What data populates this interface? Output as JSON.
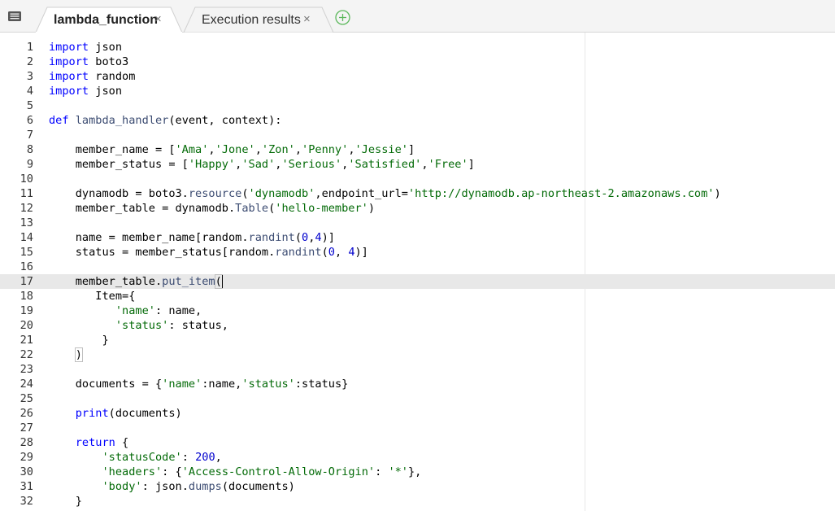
{
  "tabs": [
    {
      "label": "lambda_function",
      "close": "×",
      "active": true
    },
    {
      "label": "Execution results",
      "close": "×",
      "active": false
    }
  ],
  "add_tab_icon": "plus-circle-icon",
  "menu_icon": "menu-list-icon",
  "editor": {
    "active_line": 17,
    "lines": [
      [
        {
          "t": "import",
          "c": "kw"
        },
        {
          "t": " json"
        }
      ],
      [
        {
          "t": "import",
          "c": "kw"
        },
        {
          "t": " boto3"
        }
      ],
      [
        {
          "t": "import",
          "c": "kw"
        },
        {
          "t": " random"
        }
      ],
      [
        {
          "t": "import",
          "c": "kw"
        },
        {
          "t": " json"
        }
      ],
      [],
      [
        {
          "t": "def",
          "c": "kw"
        },
        {
          "t": " "
        },
        {
          "t": "lambda_handler",
          "c": "fn"
        },
        {
          "t": "(event, context):"
        }
      ],
      [],
      [
        {
          "t": "    member_name = ["
        },
        {
          "t": "'Ama'",
          "c": "str"
        },
        {
          "t": ","
        },
        {
          "t": "'Jone'",
          "c": "str"
        },
        {
          "t": ","
        },
        {
          "t": "'Zon'",
          "c": "str"
        },
        {
          "t": ","
        },
        {
          "t": "'Penny'",
          "c": "str"
        },
        {
          "t": ","
        },
        {
          "t": "'Jessie'",
          "c": "str"
        },
        {
          "t": "]"
        }
      ],
      [
        {
          "t": "    member_status = ["
        },
        {
          "t": "'Happy'",
          "c": "str"
        },
        {
          "t": ","
        },
        {
          "t": "'Sad'",
          "c": "str"
        },
        {
          "t": ","
        },
        {
          "t": "'Serious'",
          "c": "str"
        },
        {
          "t": ","
        },
        {
          "t": "'Satisfied'",
          "c": "str"
        },
        {
          "t": ","
        },
        {
          "t": "'Free'",
          "c": "str"
        },
        {
          "t": "]"
        }
      ],
      [],
      [
        {
          "t": "    dynamodb = boto3."
        },
        {
          "t": "resource",
          "c": "fn"
        },
        {
          "t": "("
        },
        {
          "t": "'dynamodb'",
          "c": "str"
        },
        {
          "t": ",endpoint_url="
        },
        {
          "t": "'http://dynamodb.ap-northeast-2.amazonaws.com'",
          "c": "str"
        },
        {
          "t": ")"
        }
      ],
      [
        {
          "t": "    member_table = dynamodb."
        },
        {
          "t": "Table",
          "c": "fn"
        },
        {
          "t": "("
        },
        {
          "t": "'hello-member'",
          "c": "str"
        },
        {
          "t": ")"
        }
      ],
      [],
      [
        {
          "t": "    name = member_name[random."
        },
        {
          "t": "randint",
          "c": "fn"
        },
        {
          "t": "("
        },
        {
          "t": "0",
          "c": "num"
        },
        {
          "t": ","
        },
        {
          "t": "4",
          "c": "num"
        },
        {
          "t": ")]"
        }
      ],
      [
        {
          "t": "    status = member_status[random."
        },
        {
          "t": "randint",
          "c": "fn"
        },
        {
          "t": "("
        },
        {
          "t": "0",
          "c": "num"
        },
        {
          "t": ", "
        },
        {
          "t": "4",
          "c": "num"
        },
        {
          "t": ")]"
        }
      ],
      [],
      [
        {
          "t": "    member_table."
        },
        {
          "t": "put_item",
          "c": "fn"
        },
        {
          "t": "(",
          "c": "hl"
        }
      ],
      [
        {
          "t": "       Item={"
        }
      ],
      [
        {
          "t": "          "
        },
        {
          "t": "'name'",
          "c": "str"
        },
        {
          "t": ": name,"
        }
      ],
      [
        {
          "t": "          "
        },
        {
          "t": "'status'",
          "c": "str"
        },
        {
          "t": ": status,"
        }
      ],
      [
        {
          "t": "        }"
        }
      ],
      [
        {
          "t": "    "
        },
        {
          "t": ")",
          "c": "hl"
        }
      ],
      [],
      [
        {
          "t": "    documents = {"
        },
        {
          "t": "'name'",
          "c": "str"
        },
        {
          "t": ":name,"
        },
        {
          "t": "'status'",
          "c": "str"
        },
        {
          "t": ":status}"
        }
      ],
      [],
      [
        {
          "t": "    "
        },
        {
          "t": "print",
          "c": "kw"
        },
        {
          "t": "(documents)"
        }
      ],
      [],
      [
        {
          "t": "    "
        },
        {
          "t": "return",
          "c": "kw"
        },
        {
          "t": " {"
        }
      ],
      [
        {
          "t": "        "
        },
        {
          "t": "'statusCode'",
          "c": "str"
        },
        {
          "t": ": "
        },
        {
          "t": "200",
          "c": "num"
        },
        {
          "t": ","
        }
      ],
      [
        {
          "t": "        "
        },
        {
          "t": "'headers'",
          "c": "str"
        },
        {
          "t": ": {"
        },
        {
          "t": "'Access-Control-Allow-Origin'",
          "c": "str"
        },
        {
          "t": ": "
        },
        {
          "t": "'*'",
          "c": "str"
        },
        {
          "t": "},"
        }
      ],
      [
        {
          "t": "        "
        },
        {
          "t": "'body'",
          "c": "str"
        },
        {
          "t": ": json."
        },
        {
          "t": "dumps",
          "c": "fn"
        },
        {
          "t": "(documents)"
        }
      ],
      [
        {
          "t": "    }"
        }
      ]
    ]
  }
}
